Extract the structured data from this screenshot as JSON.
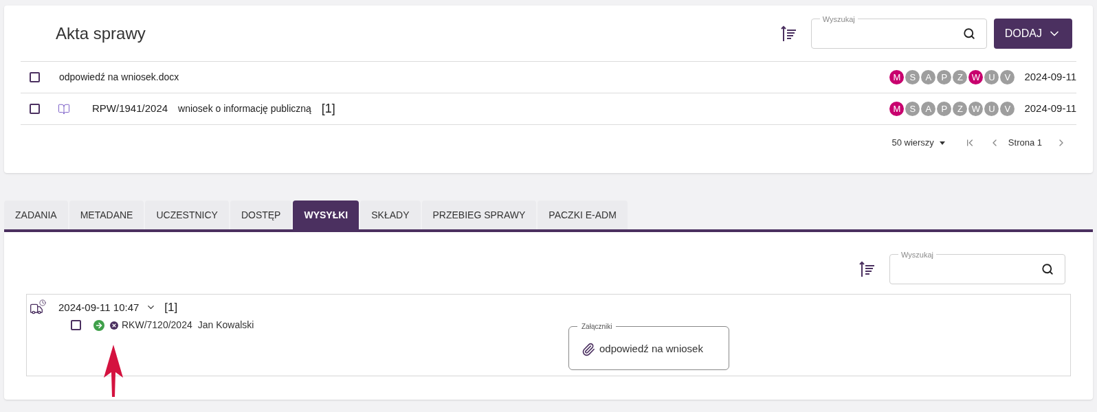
{
  "documents": {
    "title": "Akta sprawy",
    "search": {
      "label": "Wyszukaj"
    },
    "add_button": "DODAJ",
    "rows": [
      {
        "checked": false,
        "kind": "file",
        "name": "odpowiedź na wniosek.docx",
        "badges": [
          {
            "letter": "M",
            "on": true
          },
          {
            "letter": "S",
            "on": false
          },
          {
            "letter": "A",
            "on": false
          },
          {
            "letter": "P",
            "on": false
          },
          {
            "letter": "Z",
            "on": false
          },
          {
            "letter": "W",
            "on": true
          },
          {
            "letter": "U",
            "on": false
          },
          {
            "letter": "V",
            "on": false
          }
        ],
        "date": "2024-09-11"
      },
      {
        "checked": false,
        "kind": "case",
        "number": "RPW/1941/2024",
        "name": "wniosek o informację publiczną",
        "count": "[1]",
        "badges": [
          {
            "letter": "M",
            "on": true
          },
          {
            "letter": "S",
            "on": false
          },
          {
            "letter": "A",
            "on": false
          },
          {
            "letter": "P",
            "on": false
          },
          {
            "letter": "Z",
            "on": false
          },
          {
            "letter": "W",
            "on": false
          },
          {
            "letter": "U",
            "on": false
          },
          {
            "letter": "V",
            "on": false
          }
        ],
        "date": "2024-09-11"
      }
    ],
    "pagination": {
      "rows_per_page": "50 wierszy",
      "page": "Strona 1"
    }
  },
  "tabs": [
    {
      "label": "ZADANIA",
      "selected": false
    },
    {
      "label": "METADANE",
      "selected": false
    },
    {
      "label": "UCZESTNICY",
      "selected": false
    },
    {
      "label": "DOSTĘP",
      "selected": false
    },
    {
      "label": "WYSYŁKI",
      "selected": true
    },
    {
      "label": "SKŁADY",
      "selected": false
    },
    {
      "label": "PRZEBIEG SPRAWY",
      "selected": false
    },
    {
      "label": "PACZKI E-ADM",
      "selected": false
    }
  ],
  "shipments": {
    "search": {
      "label": "Wyszukaj"
    },
    "groups": [
      {
        "datetime": "2024-09-11 10:47",
        "count": "[1]",
        "expanded": true,
        "items": [
          {
            "checked": false,
            "number": "RKW/7120/2024",
            "recipient": "Jan Kowalski",
            "attachments": {
              "label": "Załączniki",
              "files": [
                "odpowiedź na wniosek"
              ]
            }
          }
        ]
      }
    ]
  }
}
